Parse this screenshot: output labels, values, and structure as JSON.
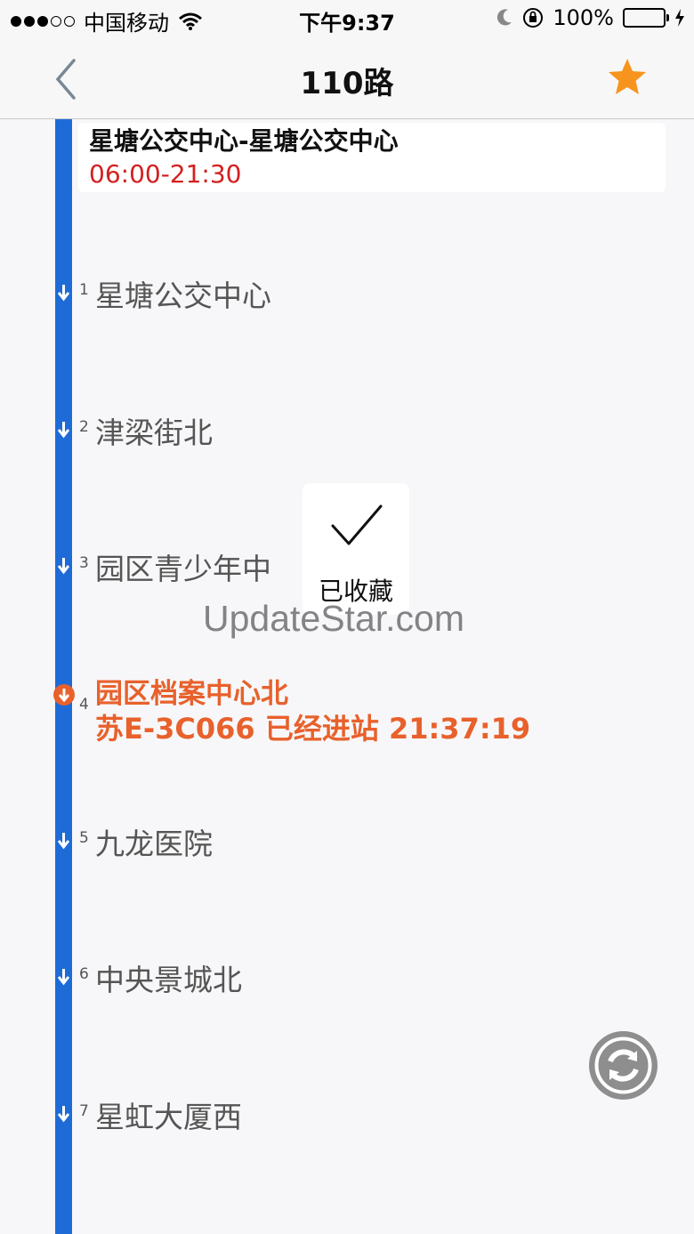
{
  "status_bar": {
    "carrier": "中国移动",
    "time": "下午9:37",
    "battery": "100%",
    "icons": [
      "signal-dots",
      "wifi-icon",
      "moon-icon",
      "rotation-lock-icon",
      "battery-icon",
      "charging-icon"
    ]
  },
  "nav": {
    "title": "110路",
    "back_icon": "chevron-left-icon",
    "favorite_icon": "star-icon",
    "accent_color": "#f7941d"
  },
  "route": {
    "name": "星塘公交中心-星塘公交中心",
    "hours": "06:00-21:30",
    "line_color": "#1e6bd8"
  },
  "stops": [
    {
      "num": "1",
      "name": "星塘公交中心"
    },
    {
      "num": "2",
      "name": "津梁街北"
    },
    {
      "num": "3",
      "name": "园区青少年中"
    },
    {
      "num": "4",
      "name": "园区档案中心北",
      "bus_info": "苏E-3C066 已经进站 21:37:19",
      "current": true
    },
    {
      "num": "5",
      "name": "九龙医院"
    },
    {
      "num": "6",
      "name": "中央景城北"
    },
    {
      "num": "7",
      "name": "星虹大厦西"
    }
  ],
  "toast": {
    "message": "已收藏",
    "icon": "checkmark-icon"
  },
  "watermark": "UpdateStar.com",
  "refresh": {
    "icon": "refresh-icon"
  }
}
